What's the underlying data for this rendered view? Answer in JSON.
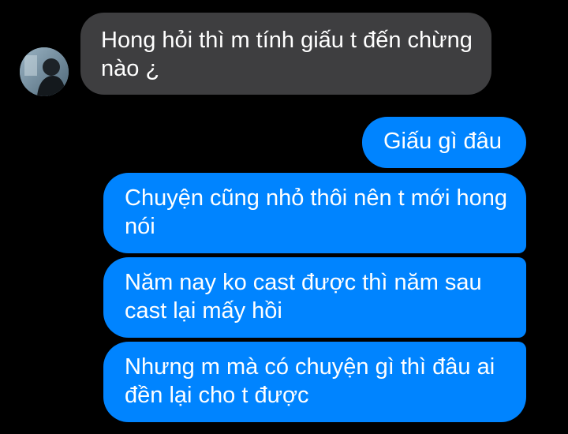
{
  "conversation": {
    "incoming": [
      {
        "text": "Hong hỏi thì m tính giấu t đến chừng nào ¿"
      }
    ],
    "outgoing": [
      {
        "text": "Giấu gì đâu"
      },
      {
        "text": "Chuyện cũng nhỏ thôi nên t mới hong nói"
      },
      {
        "text": "Năm nay ko cast được thì năm sau cast lại mấy hồi"
      },
      {
        "text": "Nhưng m mà có chuyện gì thì đâu ai đền lại cho t được"
      }
    ]
  },
  "colors": {
    "background": "#000000",
    "incoming_bubble": "#3e3e40",
    "outgoing_bubble": "#0084ff",
    "text": "#ffffff"
  }
}
